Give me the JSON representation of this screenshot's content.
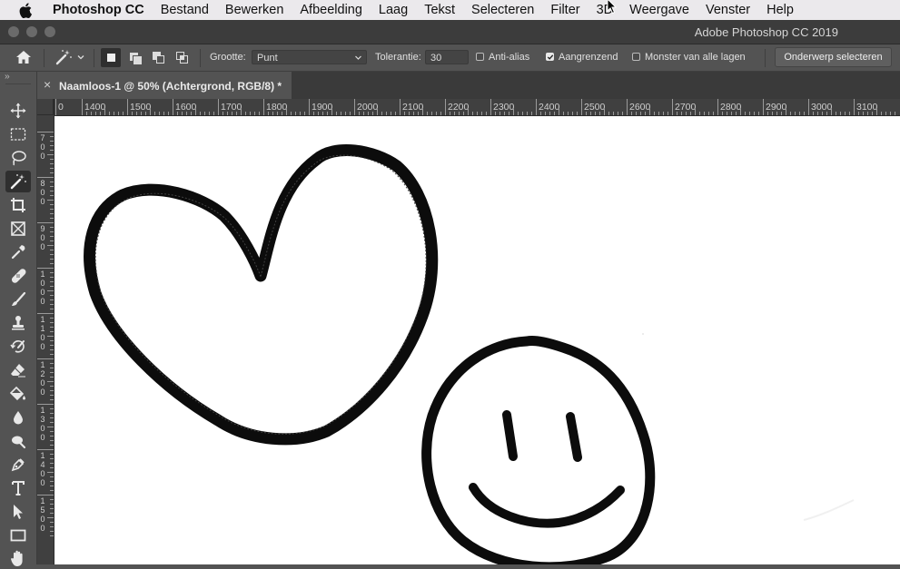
{
  "menubar": {
    "app_name": "Photoshop CC",
    "items": [
      "Bestand",
      "Bewerken",
      "Afbeelding",
      "Laag",
      "Tekst",
      "Selecteren",
      "Filter",
      "3D",
      "Weergave",
      "Venster",
      "Help"
    ]
  },
  "window": {
    "title": "Adobe Photoshop CC 2019"
  },
  "options": {
    "size_label": "Grootte:",
    "size_value": "Punt",
    "tolerance_label": "Tolerantie:",
    "tolerance_value": "30",
    "anti_alias_label": "Anti-alias",
    "anti_alias_checked": false,
    "contiguous_label": "Aangrenzend",
    "contiguous_checked": true,
    "sample_all_label": "Monster van alle lagen",
    "sample_all_checked": false,
    "select_subject_label": "Onderwerp selecteren"
  },
  "document": {
    "tab_title": "Naamloos-1 @ 50% (Achtergrond, RGB/8) *",
    "close_glyph": "×"
  },
  "rulers": {
    "horizontal": [
      "0",
      "1400",
      "1500",
      "1600",
      "1700",
      "1800",
      "1900",
      "2000",
      "2100",
      "2200",
      "2300",
      "2400",
      "2500",
      "2600",
      "2700",
      "2800",
      "2900",
      "3000",
      "3100"
    ],
    "vertical": [
      "700",
      "800",
      "900",
      "1000",
      "1100",
      "1200",
      "1300",
      "1400",
      "1500"
    ]
  },
  "toolbar": {
    "tools": [
      "move-tool",
      "rectangular-marquee-tool",
      "lasso-tool",
      "magic-wand-tool",
      "crop-tool",
      "frame-tool",
      "eyedropper-tool",
      "healing-brush-tool",
      "brush-tool",
      "clone-stamp-tool",
      "history-brush-tool",
      "eraser-tool",
      "paint-bucket-tool",
      "blur-tool",
      "dodge-tool",
      "pen-tool",
      "type-tool",
      "path-selection-tool",
      "rectangle-tool",
      "hand-tool"
    ],
    "active_tool": "magic-wand-tool",
    "expand_glyph": "››"
  },
  "colors": {
    "ui_dark": "#535353",
    "menubar": "#ebe9ec",
    "canvas": "#ffffff",
    "ink": "#0c0c0c"
  }
}
